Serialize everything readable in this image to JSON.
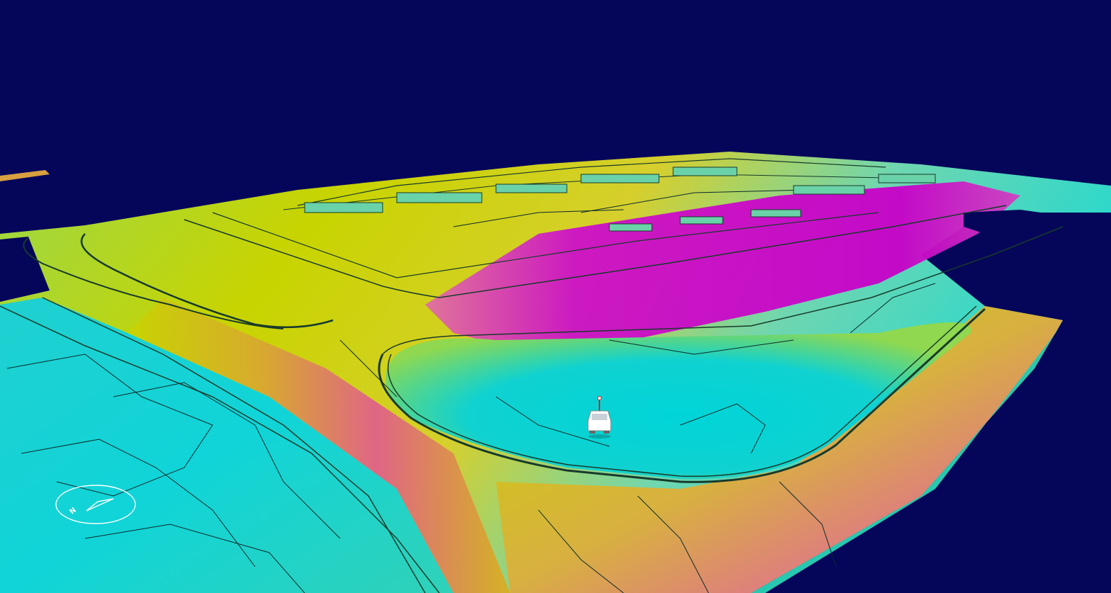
{
  "scene": {
    "type": "3d-terrain-elevation-view",
    "sky_color": "#05065a",
    "elevation_colormap": [
      "#00d2d8",
      "#5fd08a",
      "#c8d400",
      "#d8a830",
      "#e0608a",
      "#c800c8"
    ],
    "contour_line_color": "#0b2a2a"
  },
  "compass": {
    "icon": "compass-icon",
    "north_label": "N",
    "heading_deg": 40
  },
  "vehicle": {
    "icon": "car-icon",
    "body_color": "#ffffff",
    "marker_color": "#e02020"
  }
}
